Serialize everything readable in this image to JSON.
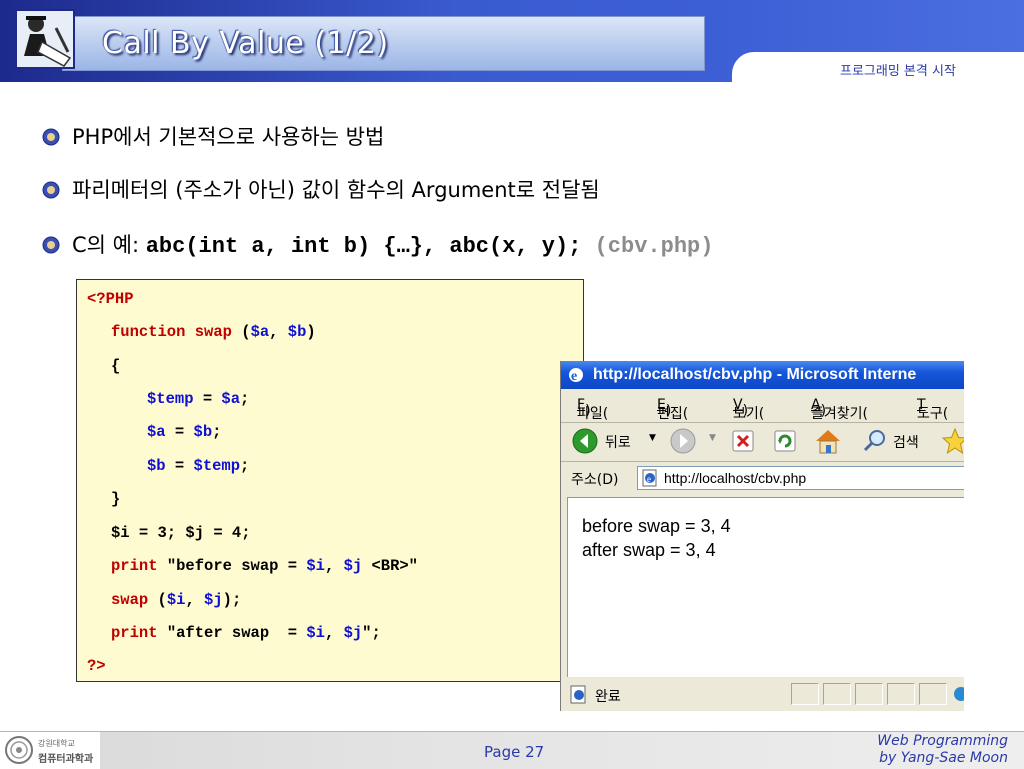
{
  "header": {
    "title": "Call By Value (1/2)",
    "subtitle": "프로그래밍 본격 시작"
  },
  "bullets": [
    {
      "text": "PHP에서 기본적으로 사용하는 방법"
    },
    {
      "text": "파리메터의 (주소가 아닌) 값이 함수의 Argument로 전달됨"
    },
    {
      "prefix": "C의 예: ",
      "code": "abc(int a, int b) {…}, abc(x, y);",
      "file": " (cbv.php)"
    }
  ],
  "code": {
    "l1": "<?PHP",
    "l2_kw": "function",
    "l2_fn": "swap",
    "l2_open": " (",
    "l2_a": "$a",
    "l2_comma": ", ",
    "l2_b": "$b",
    "l2_close": ")",
    "l3": "{",
    "l4_v1": "$temp",
    "l4_eq": " = ",
    "l4_v2": "$a",
    "l4_end": ";",
    "l5_v1": "$a",
    "l5_eq": " = ",
    "l5_v2": "$b",
    "l5_end": ";",
    "l6_v1": "$b",
    "l6_eq": " = ",
    "l6_v2": "$temp",
    "l6_end": ";",
    "l7": "}",
    "l8": "$i = 3; $j = 4;",
    "l9_kw": "print",
    "l9_str": " \"before swap = ",
    "l9_v1": "$i",
    "l9_comma": ", ",
    "l9_v2": "$j",
    "l9_end": " <BR>\"",
    "l10_fn": "swap",
    "l10_open": " (",
    "l10_v1": "$i",
    "l10_comma": ", ",
    "l10_v2": "$j",
    "l10_end": ");",
    "l11_kw": "print",
    "l11_str": " \"after swap  = ",
    "l11_v1": "$i",
    "l11_comma": ", ",
    "l11_v2": "$j",
    "l11_end": "\";",
    "l12": "?>"
  },
  "browser": {
    "title": "http://localhost/cbv.php - Microsoft Interne",
    "menu": [
      {
        "label": "파일(",
        "key": "F",
        "end": ")"
      },
      {
        "label": "편집(",
        "key": "E",
        "end": ")"
      },
      {
        "label": "보기(",
        "key": "V",
        "end": ")"
      },
      {
        "label": "즐겨찾기(",
        "key": "A",
        "end": ")"
      },
      {
        "label": "도구(",
        "key": "T",
        "end": ""
      }
    ],
    "back_label": "뒤로",
    "search_label": "검색",
    "address_label": "주소(D)",
    "address_value": "http://localhost/cbv.php",
    "output": [
      "before swap = 3, 4",
      "after swap = 3, 4"
    ],
    "status": "완료"
  },
  "footer": {
    "logo_text_1": "강원대학교",
    "logo_text_2": "컴퓨터과학과",
    "page": "Page 27",
    "credit_1": "Web Programming",
    "credit_2": "by Yang-Sae Moon"
  },
  "colors": {
    "header_band": "#3a5bd0",
    "keyword": "#c00000",
    "variable": "#1010d0",
    "code_bg": "#fffbd0",
    "accent_text": "#2a3aa8"
  }
}
